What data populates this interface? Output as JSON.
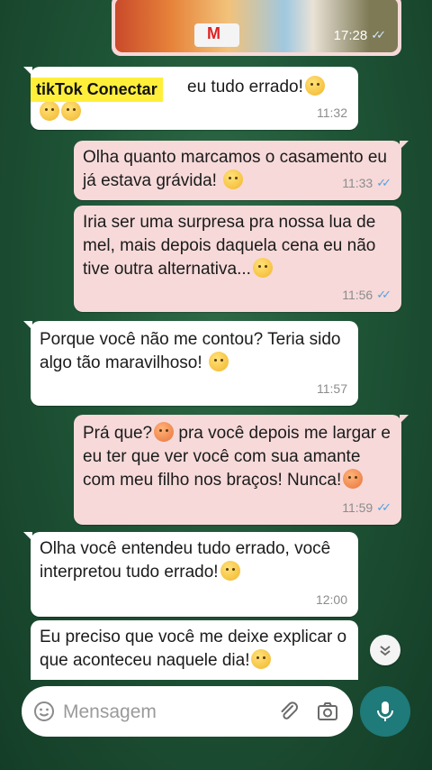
{
  "brand": {
    "label": "tikTok Conectar"
  },
  "image_message": {
    "time": "17:28",
    "cake_letter": "M"
  },
  "messages": [
    {
      "text": "eu tudo errado!",
      "time": "11:32",
      "direction": "in"
    },
    {
      "text": "Olha quanto marcamos o casamento eu já estava grávida! ",
      "time": "11:33",
      "direction": "out"
    },
    {
      "text": "Iria ser uma surpresa pra nossa lua de mel, mais depois daquela cena eu não tive outra alternativa...",
      "time": "11:56",
      "direction": "out"
    },
    {
      "text": "Porque você não me contou? Teria sido algo tão maravilhoso! ",
      "time": "11:57",
      "direction": "in"
    },
    {
      "text_a": "Prá que?",
      "text_b": " pra você depois me largar e eu ter que ver você com sua amante com meu filho nos braços! Nunca!",
      "time": "11:59",
      "direction": "out"
    },
    {
      "text": "Olha você entendeu tudo errado, você interpretou tudo errado!",
      "time": "12:00",
      "direction": "in"
    },
    {
      "text": "Eu preciso que você me deixe explicar o que aconteceu naquele dia!",
      "time": "",
      "direction": "in"
    }
  ],
  "composer": {
    "placeholder": "Mensagem"
  },
  "colors": {
    "incoming": "#ffffff",
    "outgoing": "#f7d9d9",
    "accent": "#1f7a7a",
    "ticks": "#4fa3e0"
  },
  "icons": [
    "emoji-icon",
    "attach-icon",
    "camera-icon",
    "mic-icon",
    "chevron-down-icon",
    "double-check-icon"
  ]
}
